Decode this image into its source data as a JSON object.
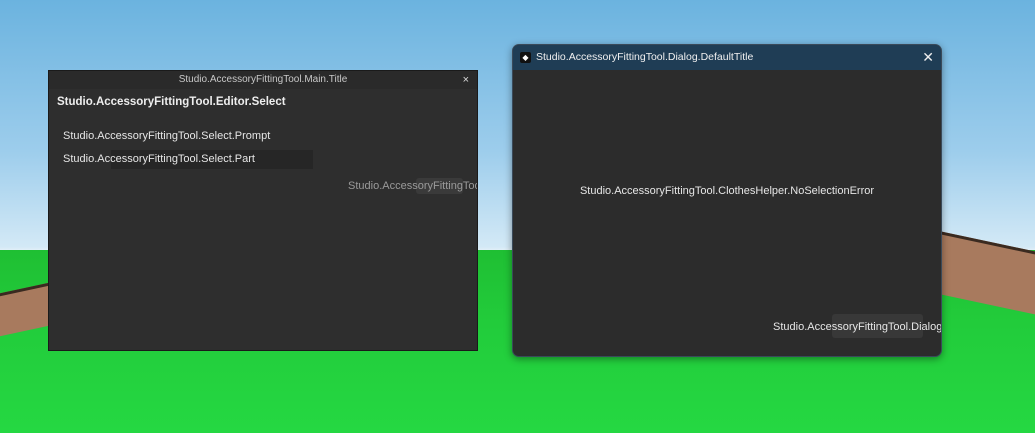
{
  "main_window": {
    "title": "Studio.AccessoryFittingTool.Main.Title",
    "close_label": "×",
    "heading": "Studio.AccessoryFittingTool.Editor.Select",
    "prompt": "Studio.AccessoryFittingTool.Select.Prompt",
    "part_label": "Studio.AccessoryFittingTool.Select.Part",
    "overflow_button": "Studio.AccessoryFittingToo"
  },
  "dialog": {
    "title": "Studio.AccessoryFittingTool.Dialog.DefaultTitle",
    "close_label": "✕",
    "message": "Studio.AccessoryFittingTool.ClothesHelper.NoSelectionError",
    "button_label": "Studio.AccessoryFittingTool.Dialog"
  }
}
